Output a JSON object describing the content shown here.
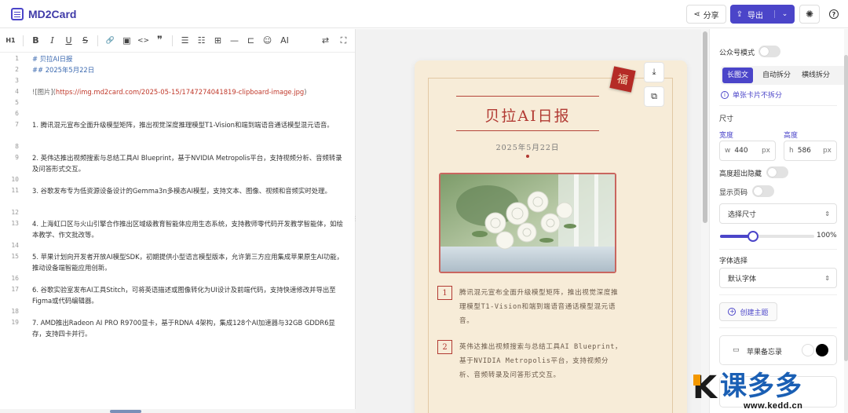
{
  "app": {
    "title": "MD2Card"
  },
  "header": {
    "share_label": "分享",
    "export_label": "导出",
    "share_icon": "share-icon",
    "export_icon": "export-icon",
    "theme_icon": "sun-icon",
    "help_icon": "help-icon"
  },
  "toolbar": {
    "items": [
      "H1",
      "B",
      "I",
      "U",
      "S",
      "🔗",
      "▣",
      "<>",
      "❞",
      "☰",
      "☷",
      "⊞",
      "—",
      "⊏",
      "☺",
      "AI"
    ],
    "right_items": [
      "⇄",
      "⛶"
    ]
  },
  "editor": {
    "line_numbers": [
      "1",
      "2",
      "3",
      "4",
      "5",
      "6",
      "7",
      "8",
      "9",
      "10",
      "11",
      "12",
      "13",
      "14",
      "15",
      "16",
      "17",
      "18",
      "19"
    ],
    "lines": {
      "l1": "# 贝拉AI日报",
      "l2": "##  2025年5月22日",
      "l4_prefix": "![图片](",
      "l4_link": "https://img.md2card.com/2025-05-15/1747274041819-clipboard-image.jpg",
      "l4_suffix": ")",
      "l7": "1. 腾讯混元宣布全面升级模型矩阵，推出视觉深度推理模型T1-Vision和端到端语音通话模型混元语音。",
      "l9": "2. 英伟达推出视频搜索与总结工具AI Blueprint，基于NVIDIA Metropolis平台，支持视频分析、音频转录及问答形式交互。",
      "l11": "3. 谷歌发布专为低资源设备设计的Gemma3n多模态AI模型，支持文本、图像、视频和音频实时处理。",
      "l13": "4. 上海虹口区与火山引擎合作推出区域级教育智能体应用生态系统，支持教师零代码开发教学智能体，如绘本教学、作文批改等。",
      "l15": "5. 苹果计划向开发者开放AI模型SDK，初期提供小型语言模型版本，允许第三方应用集成苹果原生AI功能，推动设备端智能应用创新。",
      "l17": "6. 谷歌实验室发布AI工具Stitch，可将英语描述或图像转化为UI设计及前端代码，支持快速修改并导出至Figma或代码编辑器。",
      "l19": "7. AMD推出Radeon AI PRO R9700显卡，基于RDNA 4架构，集成128个AI加速器与32GB GDDR6显存，支持四卡并行。"
    }
  },
  "card": {
    "badge": "福",
    "title": "贝拉AI日报",
    "date": "2025年5月22日",
    "items": [
      {
        "num": "1",
        "text": "腾讯混元宣布全面升级模型矩阵，推出视觉深度推理模型T1-Vision和端到端语音通话模型混元语音。"
      },
      {
        "num": "2",
        "text": "英伟达推出视频搜索与总结工具AI Blueprint，基于NVIDIA Metropolis平台，支持视频分析、音频转录及问答形式交互。"
      }
    ],
    "download_icon": "download-icon",
    "copy_icon": "copy-icon"
  },
  "panel": {
    "wechat_mode_label": "公众号模式",
    "split_modes": [
      "长图文",
      "自动拆分",
      "横线拆分"
    ],
    "info_text": "单张卡片不拆分",
    "size_label": "尺寸",
    "width_label": "宽度",
    "height_label": "高度",
    "width_prefix": "w",
    "height_prefix": "h",
    "width_value": "440",
    "height_value": "586",
    "unit": "px",
    "overflow_hidden_label": "高度超出隐藏",
    "show_page_label": "显示页码",
    "size_select": "选择尺寸",
    "zoom_percent": "100%",
    "zoom_value": 0.35,
    "font_label": "字体选择",
    "font_select": "默认字体",
    "create_theme": "创建主题",
    "theme_name": "苹果备忘录",
    "colors": {
      "accent": "#4b45c9",
      "swatch_white": "#ffffff",
      "swatch_black": "#000000"
    }
  },
  "watermark": {
    "brand": "课多多",
    "url": "www.kedd.cn",
    "letter": "K"
  }
}
